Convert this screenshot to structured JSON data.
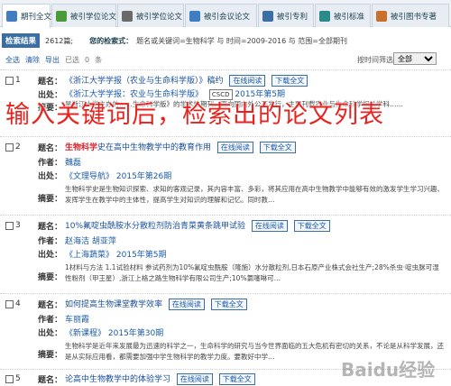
{
  "tabs": [
    {
      "label": "期刊全文",
      "icon": "journal-icon",
      "color": "#3f7fc1",
      "active": true
    },
    {
      "label": "被引学位论文",
      "icon": "thesis-icon",
      "color": "#4a9a3a",
      "active": false
    },
    {
      "label": "被引学位论文",
      "icon": "degree-icon",
      "color": "#6a6a6a",
      "active": false
    },
    {
      "label": "被引会议论文",
      "icon": "conference-icon",
      "color": "#3f7fc1",
      "active": false
    },
    {
      "label": "被引专利",
      "icon": "patent-icon",
      "color": "#3a6ea5",
      "active": false
    },
    {
      "label": "被引标准",
      "icon": "standard-icon",
      "color": "#2d8a8a",
      "active": false
    },
    {
      "label": "被引图书专著",
      "icon": "book-icon",
      "color": "#c9702a",
      "active": false
    }
  ],
  "info": {
    "badge": "检索结果",
    "count": "2612篇;",
    "query_label": "您的检索式：",
    "query": "题名或关键词=生物科学 与 时间=2009-2016 与 范围=全部期刊"
  },
  "toolbar": {
    "select_all": "全选",
    "clear": "清除",
    "export": "导出",
    "selected": "已选",
    "selected_count": "0",
    "unit": "条",
    "sort_label": "按时间筛选",
    "sort_value": "全部"
  },
  "overlay_text": "输入关键词后，检索出的论文列表",
  "watermark": "Baidu经验",
  "labels": {
    "title": "题名：",
    "author": "作者：",
    "source": "出处：",
    "abstract": "摘要："
  },
  "buttons": {
    "read": "在线阅读",
    "download": "下载全文"
  },
  "items": [
    {
      "num": "1",
      "title_pre": "《",
      "title_hl": "",
      "title_post": "浙江大学学报（农业与生命科学版）》稿约",
      "source": "《浙江大学学报：农业与生命科学版》",
      "csco": "CSCD",
      "source_year": "2015年第5期",
      "abstract": "是浙江大学主办的……生命科学版》的学术性期刊，面向国内外公开发行，主要刊载农业与生命科学相关学科……"
    },
    {
      "num": "2",
      "title_pre": "",
      "title_hl": "生物科学",
      "title_post": "史在高中生物教学中的教育作用",
      "author": "魏磊",
      "source": "《文理导航》",
      "source_year": "2015年第26期",
      "abstract": "生物科学史是生物知识探索、求知的客观记录，其内容丰富、多彩，将其应用在高中生物教学中能够有效的激发学生学习兴趣、发挥学生在教学中的主体性，提高学生对知识的理解和记忆。同时教…"
    },
    {
      "num": "3",
      "title_pre": "",
      "title_hl": "",
      "title_post": "10%氟啶虫酰胺水分散粒剂防治青菜黄条跳甲试验",
      "author": "赵海洁 胡亚萍",
      "source": "《上海蔬菜》",
      "source_year": "2015年第5期",
      "abstract": "1材料与方法 1.1试验材料 参试药剂为10%氟啶虫酰胺（隆施）水分散粒剂,日本石原产业株式会社生产;28%杀虫·啶虫脒可湿性粉剂（甲王星）,浙江上格之路生物科学有限公司生产;10%氯噻啉可…"
    },
    {
      "num": "4",
      "title_pre": "",
      "title_hl": "",
      "title_post": "如何提高生物课堂教学效率",
      "author": "车丽霞",
      "source": "《新课程》",
      "source_year": "2015年第30期",
      "abstract": "生物科学是近年来发展最为迅速的科学之一，生命科学的研究与当今世界面临的五大危机有密切的关系，不论是从科学发展，还是从实际应用看，都需要加强中学生物科学的教学力度。要教好中学…"
    },
    {
      "num": "5",
      "title_pre": "",
      "title_hl": "",
      "title_post": "论高中生物教学中的体验学习",
      "author": "",
      "source": "",
      "source_year": "",
      "abstract": ""
    }
  ]
}
